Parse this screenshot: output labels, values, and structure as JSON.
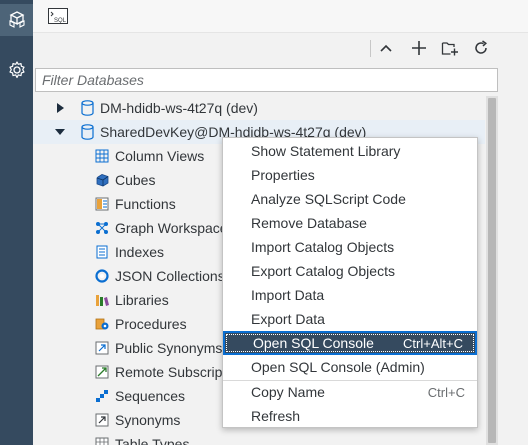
{
  "activity_bar": {
    "items": [
      {
        "icon": "database-cubes-icon",
        "active": true
      },
      {
        "icon": "gear-icon",
        "active": false
      }
    ]
  },
  "top_tab": {
    "icon": "sql-console-icon",
    "icon_text": "SQL"
  },
  "toolbar": {
    "buttons": [
      {
        "icon": "collapse-chevron-up-icon"
      },
      {
        "icon": "add-plus-icon"
      },
      {
        "icon": "add-folder-icon"
      },
      {
        "icon": "refresh-icon"
      }
    ]
  },
  "filter": {
    "placeholder": "Filter Databases",
    "value": ""
  },
  "tree": {
    "databases": [
      {
        "label": "DM-hdidb-ws-4t27q (dev)",
        "expanded": false
      },
      {
        "label": "SharedDevKey@DM-hdidb-ws-4t27q (dev)",
        "expanded": true
      }
    ],
    "children": [
      {
        "label": "Column Views",
        "icon": "column-views-icon"
      },
      {
        "label": "Cubes",
        "icon": "cube-icon"
      },
      {
        "label": "Functions",
        "icon": "functions-icon"
      },
      {
        "label": "Graph Workspaces",
        "icon": "graph-workspace-icon"
      },
      {
        "label": "Indexes",
        "icon": "indexes-icon"
      },
      {
        "label": "JSON Collections",
        "icon": "json-collection-icon"
      },
      {
        "label": "Libraries",
        "icon": "libraries-icon"
      },
      {
        "label": "Procedures",
        "icon": "procedures-icon"
      },
      {
        "label": "Public Synonyms",
        "icon": "public-synonyms-icon"
      },
      {
        "label": "Remote Subscriptions",
        "icon": "remote-subscriptions-icon"
      },
      {
        "label": "Sequences",
        "icon": "sequences-icon"
      },
      {
        "label": "Synonyms",
        "icon": "synonyms-icon"
      },
      {
        "label": "Table Types",
        "icon": "table-types-icon"
      }
    ]
  },
  "context_menu": {
    "groups": [
      [
        {
          "label": "Show Statement Library",
          "shortcut": ""
        },
        {
          "label": "Properties",
          "shortcut": ""
        },
        {
          "label": "Analyze SQLScript Code",
          "shortcut": ""
        },
        {
          "label": "Remove Database",
          "shortcut": ""
        },
        {
          "label": "Import Catalog Objects",
          "shortcut": ""
        },
        {
          "label": "Export Catalog Objects",
          "shortcut": ""
        },
        {
          "label": "Import Data",
          "shortcut": ""
        },
        {
          "label": "Export Data",
          "shortcut": ""
        }
      ],
      [
        {
          "label": "Open SQL Console",
          "shortcut": "Ctrl+Alt+C",
          "highlighted": true
        },
        {
          "label": "Open SQL Console (Admin)",
          "shortcut": ""
        }
      ],
      [
        {
          "label": "Copy Name",
          "shortcut": "Ctrl+C"
        },
        {
          "label": "Refresh",
          "shortcut": ""
        }
      ]
    ]
  },
  "colors": {
    "activity_bar": "#354a5f",
    "highlight": "#354a5f",
    "focus_border": "#0a6ed1",
    "selected_row": "#e8eff6",
    "database_icon": "#0a6ed1"
  }
}
